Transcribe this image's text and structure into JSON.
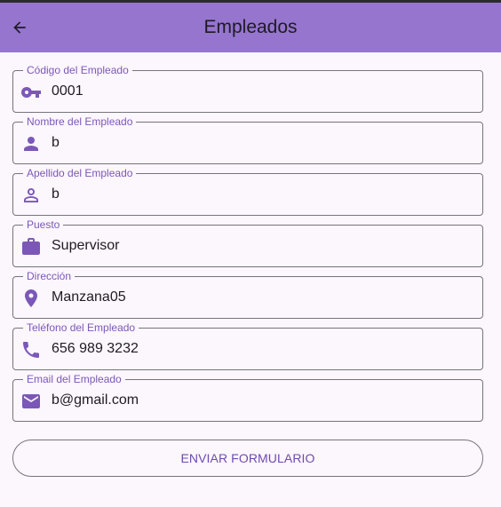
{
  "appbar": {
    "title": "Empleados",
    "back_icon": "arrow-back-icon"
  },
  "colors": {
    "appbar_bg": "#9575cd",
    "accent": "#7b58b8",
    "background": "#fcf6fd",
    "outline": "#77737c"
  },
  "form": {
    "fields": [
      {
        "label": "Código del Empleado",
        "value": "0001",
        "icon": "key-icon"
      },
      {
        "label": "Nombre del Empleado",
        "value": "b",
        "icon": "person-icon"
      },
      {
        "label": "Apellido del Empleado",
        "value": "b",
        "icon": "person-outline-icon"
      },
      {
        "label": "Puesto",
        "value": "Supervisor",
        "icon": "work-icon"
      },
      {
        "label": "Dirección",
        "value": "Manzana05",
        "icon": "location-pin-icon"
      },
      {
        "label": "Teléfono del Empleado",
        "value": "656 989 3232",
        "icon": "phone-icon"
      },
      {
        "label": "Email del Empleado",
        "value": "b@gmail.com",
        "icon": "email-icon"
      }
    ],
    "submit_label": "ENVIAR FORMULARIO"
  }
}
